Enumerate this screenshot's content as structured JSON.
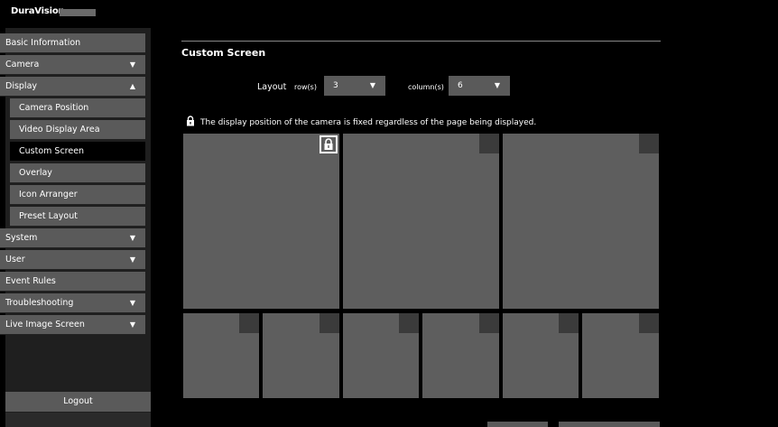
{
  "app": {
    "brand": "DuraVision"
  },
  "sidebar": {
    "items": [
      {
        "label": "Basic Information",
        "arrow": ""
      },
      {
        "label": "Camera",
        "arrow": "▼"
      },
      {
        "label": "Display",
        "arrow": "▲"
      },
      {
        "label": "Camera Position",
        "arrow": ""
      },
      {
        "label": "Video Display Area",
        "arrow": ""
      },
      {
        "label": "Custom Screen",
        "arrow": ""
      },
      {
        "label": "Overlay",
        "arrow": ""
      },
      {
        "label": "Icon Arranger",
        "arrow": ""
      },
      {
        "label": "Preset Layout",
        "arrow": ""
      },
      {
        "label": "System",
        "arrow": "▼"
      },
      {
        "label": "User",
        "arrow": "▼"
      },
      {
        "label": "Event Rules",
        "arrow": ""
      },
      {
        "label": "Troubleshooting",
        "arrow": "▼"
      },
      {
        "label": "Live Image Screen",
        "arrow": "▼"
      }
    ],
    "logout": "Logout"
  },
  "main": {
    "title": "Custom Screen",
    "layout_label": "Layout",
    "row_label": "row(s)",
    "row_value": "3",
    "column_label": "column(s)",
    "column_value": "6",
    "dropdown_arrow": "▼",
    "notice": "The display position of the camera is fixed regardless of the page being displayed."
  },
  "colors": {
    "tile": "#5e5e5e",
    "corner": "#3b3b3b",
    "nav": "#5a5a5a",
    "active": "#000000"
  }
}
